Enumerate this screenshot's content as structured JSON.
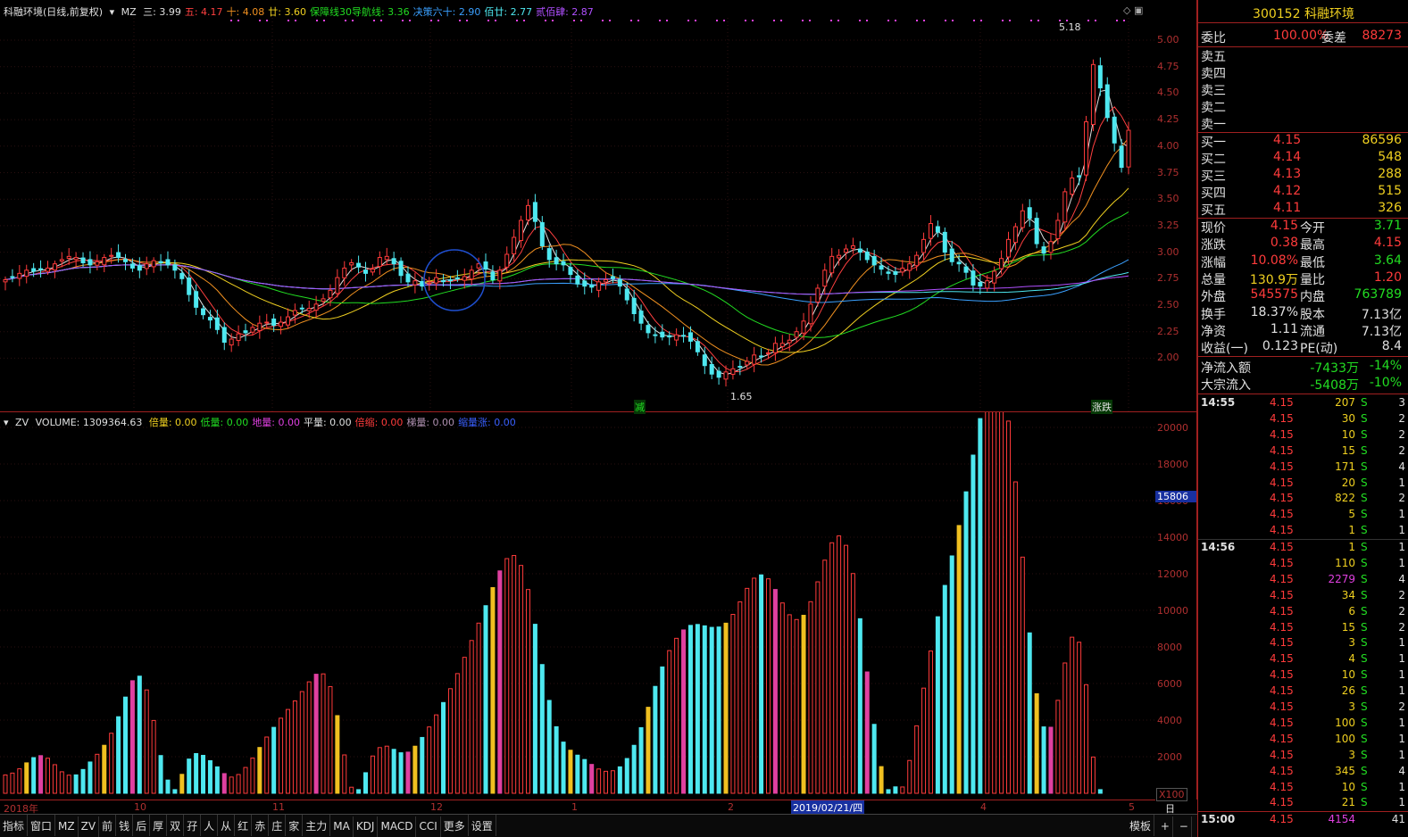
{
  "price_header": {
    "title": "科融环境(日线,前复权)",
    "indicator": "MZ",
    "items": [
      {
        "label": "三: 3.99",
        "color": "#e0e0e0"
      },
      {
        "label": "五: 4.17",
        "color": "#ff4040"
      },
      {
        "label": "十: 4.08",
        "color": "#f09020"
      },
      {
        "label": "廿: 3.60",
        "color": "#f0d020"
      },
      {
        "label": "保障线30导航线: 3.36",
        "color": "#22dd22"
      },
      {
        "label": "决策六十: 2.90",
        "color": "#3aa0ff"
      },
      {
        "label": "佰廿: 2.77",
        "color": "#4ee8f0"
      },
      {
        "label": "贰佰肆: 2.87",
        "color": "#b050ff"
      }
    ]
  },
  "volume_header": {
    "indicator": "ZV",
    "volume": "VOLUME: 1309364.63",
    "items": [
      {
        "label": "倍量: 0.00",
        "color": "#f0d020"
      },
      {
        "label": "低量: 0.00",
        "color": "#22dd22"
      },
      {
        "label": "地量: 0.00",
        "color": "#e040e0"
      },
      {
        "label": "平量: 0.00",
        "color": "#e0e0e0"
      },
      {
        "label": "倍缩: 0.00",
        "color": "#ff3b3b"
      },
      {
        "label": "梯量: 0.00",
        "color": "#b090b0"
      },
      {
        "label": "缩量涨: 0.00",
        "color": "#3a60ff"
      }
    ]
  },
  "price_axis": [
    "5.00",
    "4.75",
    "4.50",
    "4.25",
    "4.00",
    "3.75",
    "3.50",
    "3.25",
    "3.00",
    "2.75",
    "2.50",
    "2.25",
    "2.00"
  ],
  "volume_axis": [
    "20000",
    "18000",
    "16000",
    "14000",
    "12000",
    "10000",
    "8000",
    "6000",
    "4000",
    "2000"
  ],
  "volume_marker": "15806",
  "volume_scale": "X100",
  "annotations": {
    "high": "5.18",
    "low": "1.65",
    "sig1": "减",
    "sig2": "涨跌"
  },
  "x_axis": {
    "labels": [
      "2018年",
      "10",
      "11",
      "12",
      "1",
      "2",
      "4",
      "5"
    ],
    "cursor": "2019/02/21/四",
    "period": "日线"
  },
  "toolbar": [
    "指标",
    "窗口",
    "MZ",
    "ZV",
    "前",
    "钱",
    "后",
    "厚",
    "双",
    "孖",
    "人",
    "从",
    "红",
    "赤",
    "庄",
    "家",
    "主力",
    "MA",
    "KDJ",
    "MACD",
    "CCI",
    "更多",
    "设置"
  ],
  "toolbar_right": {
    "template": "模板",
    "plus": "+",
    "minus": "−"
  },
  "stock": {
    "code": "300152",
    "name": "科融环境"
  },
  "weibi": {
    "label1": "委比",
    "value1": "100.00%",
    "label2": "委差",
    "value2": "88273"
  },
  "sell": [
    {
      "label": "卖五"
    },
    {
      "label": "卖四"
    },
    {
      "label": "卖三"
    },
    {
      "label": "卖二"
    },
    {
      "label": "卖一"
    }
  ],
  "buy": [
    {
      "label": "买一",
      "price": "4.15",
      "vol": "86596"
    },
    {
      "label": "买二",
      "price": "4.14",
      "vol": "548"
    },
    {
      "label": "买三",
      "price": "4.13",
      "vol": "288"
    },
    {
      "label": "买四",
      "price": "4.12",
      "vol": "515"
    },
    {
      "label": "买五",
      "price": "4.11",
      "vol": "326"
    }
  ],
  "stats": [
    {
      "l1": "现价",
      "v1": "4.15",
      "c1": "#ff3b3b",
      "l2": "今开",
      "v2": "3.71",
      "c2": "#22dd22"
    },
    {
      "l1": "涨跌",
      "v1": "0.38",
      "c1": "#ff3b3b",
      "l2": "最高",
      "v2": "4.15",
      "c2": "#ff3b3b"
    },
    {
      "l1": "涨幅",
      "v1": "10.08%",
      "c1": "#ff3b3b",
      "l2": "最低",
      "v2": "3.64",
      "c2": "#22dd22"
    },
    {
      "l1": "总量",
      "v1": "130.9万",
      "c1": "#f0d020",
      "l2": "量比",
      "v2": "1.20",
      "c2": "#ff3b3b"
    },
    {
      "l1": "外盘",
      "v1": "545575",
      "c1": "#ff3b3b",
      "l2": "内盘",
      "v2": "763789",
      "c2": "#22dd22"
    },
    {
      "l1": "换手",
      "v1": "18.37%",
      "c1": "#e0e0e0",
      "l2": "股本",
      "v2": "7.13亿",
      "c2": "#e0e0e0"
    },
    {
      "l1": "净资",
      "v1": "1.11",
      "c1": "#e0e0e0",
      "l2": "流通",
      "v2": "7.13亿",
      "c2": "#e0e0e0"
    },
    {
      "l1": "收益(一)",
      "v1": "0.123",
      "c1": "#e0e0e0",
      "l2": "PE(动)",
      "v2": "8.4",
      "c2": "#e0e0e0"
    }
  ],
  "flow": [
    {
      "label": "净流入额",
      "value": "-7433万",
      "pct": "-14%"
    },
    {
      "label": "大宗流入",
      "value": "-5408万",
      "pct": "-10%"
    }
  ],
  "ticks1_time": "14:55",
  "ticks1": [
    {
      "p": "4.15",
      "v": "207",
      "s": "S",
      "n": "3"
    },
    {
      "p": "4.15",
      "v": "30",
      "s": "S",
      "n": "2"
    },
    {
      "p": "4.15",
      "v": "10",
      "s": "S",
      "n": "2"
    },
    {
      "p": "4.15",
      "v": "15",
      "s": "S",
      "n": "2"
    },
    {
      "p": "4.15",
      "v": "171",
      "s": "S",
      "n": "4"
    },
    {
      "p": "4.15",
      "v": "20",
      "s": "S",
      "n": "1"
    },
    {
      "p": "4.15",
      "v": "822",
      "s": "S",
      "n": "2"
    },
    {
      "p": "4.15",
      "v": "5",
      "s": "S",
      "n": "1"
    },
    {
      "p": "4.15",
      "v": "1",
      "s": "S",
      "n": "1"
    }
  ],
  "ticks2_time": "14:56",
  "ticks2": [
    {
      "p": "4.15",
      "v": "1",
      "s": "S",
      "n": "1"
    },
    {
      "p": "4.15",
      "v": "110",
      "s": "S",
      "n": "1"
    },
    {
      "p": "4.15",
      "v": "2279",
      "s": "S",
      "n": "4"
    },
    {
      "p": "4.15",
      "v": "34",
      "s": "S",
      "n": "2"
    },
    {
      "p": "4.15",
      "v": "6",
      "s": "S",
      "n": "2"
    },
    {
      "p": "4.15",
      "v": "15",
      "s": "S",
      "n": "2"
    },
    {
      "p": "4.15",
      "v": "3",
      "s": "S",
      "n": "1"
    },
    {
      "p": "4.15",
      "v": "4",
      "s": "S",
      "n": "1"
    },
    {
      "p": "4.15",
      "v": "10",
      "s": "S",
      "n": "1"
    },
    {
      "p": "4.15",
      "v": "26",
      "s": "S",
      "n": "1"
    },
    {
      "p": "4.15",
      "v": "3",
      "s": "S",
      "n": "2"
    },
    {
      "p": "4.15",
      "v": "100",
      "s": "S",
      "n": "1"
    },
    {
      "p": "4.15",
      "v": "100",
      "s": "S",
      "n": "1"
    },
    {
      "p": "4.15",
      "v": "3",
      "s": "S",
      "n": "1"
    },
    {
      "p": "4.15",
      "v": "345",
      "s": "S",
      "n": "4"
    },
    {
      "p": "4.15",
      "v": "10",
      "s": "S",
      "n": "1"
    },
    {
      "p": "4.15",
      "v": "21",
      "s": "S",
      "n": "1"
    }
  ],
  "last_tick": {
    "time": "15:00",
    "p": "4.15",
    "v": "4154",
    "n": "41"
  },
  "chart_data": {
    "type": "candlestick",
    "prices": [
      2.74,
      2.76,
      2.8,
      2.83,
      2.82,
      2.84,
      2.85,
      2.89,
      2.93,
      2.96,
      2.95,
      2.9,
      2.88,
      2.91,
      2.95,
      2.97,
      2.95,
      2.91,
      2.85,
      2.83,
      2.89,
      2.92,
      2.9,
      2.88,
      2.83,
      2.75,
      2.6,
      2.48,
      2.41,
      2.36,
      2.27,
      2.15,
      2.18,
      2.23,
      2.24,
      2.29,
      2.33,
      2.34,
      2.31,
      2.34,
      2.39,
      2.45,
      2.47,
      2.47,
      2.51,
      2.56,
      2.64,
      2.76,
      2.85,
      2.9,
      2.86,
      2.8,
      2.84,
      2.95,
      2.96,
      2.89,
      2.78,
      2.72,
      2.73,
      2.68,
      2.71,
      2.76,
      2.73,
      2.73,
      2.75,
      2.77,
      2.83,
      2.89,
      2.84,
      2.74,
      2.83,
      2.98,
      3.14,
      3.3,
      3.44,
      3.29,
      3.06,
      2.93,
      2.89,
      2.88,
      2.79,
      2.7,
      2.68,
      2.67,
      2.72,
      2.74,
      2.75,
      2.68,
      2.55,
      2.42,
      2.33,
      2.24,
      2.22,
      2.2,
      2.2,
      2.22,
      2.21,
      2.16,
      2.06,
      1.93,
      1.85,
      1.82,
      1.87,
      1.9,
      1.92,
      1.97,
      2.03,
      2.02,
      2.05,
      2.14,
      2.14,
      2.17,
      2.25,
      2.35,
      2.51,
      2.66,
      2.83,
      2.96,
      2.97,
      3.03,
      3.06,
      3.0,
      2.93,
      2.88,
      2.84,
      2.8,
      2.79,
      2.85,
      2.89,
      2.97,
      3.12,
      3.27,
      3.19,
      3.0,
      2.91,
      2.89,
      2.81,
      2.69,
      2.68,
      2.73,
      2.82,
      2.94,
      3.12,
      3.24,
      3.39,
      3.32,
      3.08,
      2.99,
      3.1,
      3.3,
      3.57,
      3.7,
      3.71,
      4.23,
      4.77,
      4.55,
      4.27,
      4.03,
      3.8,
      4.15
    ],
    "volumes": [
      1000,
      1104,
      1338,
      1663,
      1950,
      2058,
      1916,
      1563,
      1175,
      991,
      1006,
      1301,
      1710,
      2131,
      2624,
      3282,
      4184,
      5259,
      6153,
      6403,
      5649,
      3980,
      2063,
      723,
      21,
      1035,
      1871,
      2171,
      2074,
      1783,
      1445,
      1076,
      886,
      1026,
      1411,
      1924,
      2504,
      3074,
      3604,
      4105,
      4581,
      5050,
      5560,
      6092,
      6508,
      6527,
      5833,
      4245,
      2097,
      331,
      0,
      1125,
      2037,
      2497,
      2575,
      2402,
      2215,
      2250,
      2574,
      3052,
      3626,
      4286,
      4961,
      5717,
      6543,
      7432,
      8351,
      9302,
      10256,
      11244,
      12157,
      12829,
      12998,
      12455,
      11138,
      9239,
      7038,
      5076,
      3639,
      2799,
      2354,
      2085,
      1846,
      1578,
      1328,
      1202,
      1233,
      1446,
      1901,
      2622,
      3586,
      4702,
      5843,
      6907,
      7800,
      8471,
      8929,
      9178,
      9229,
      9154,
      9070,
      9090,
      9299,
      9780,
      10466,
      11202,
      11759,
      11939,
      11723,
      11141,
      10405,
      9760,
      9498,
      9731,
      10473,
      11559,
      12744,
      13695,
      14069,
      13555,
      12012,
      9543,
      6633,
      3768,
      1458,
      12,
      -352,
      344,
      1794,
      3688,
      5748,
      7777,
      9650,
      11363,
      12976,
      14638,
      16480,
      18487,
      20483,
      22103,
      22880,
      22360,
      20346,
      17023,
      12910,
      8769,
      5443,
      3629,
      3610,
      5081,
      7123,
      8531,
      8257,
      5936,
      1982,
      0
    ]
  }
}
